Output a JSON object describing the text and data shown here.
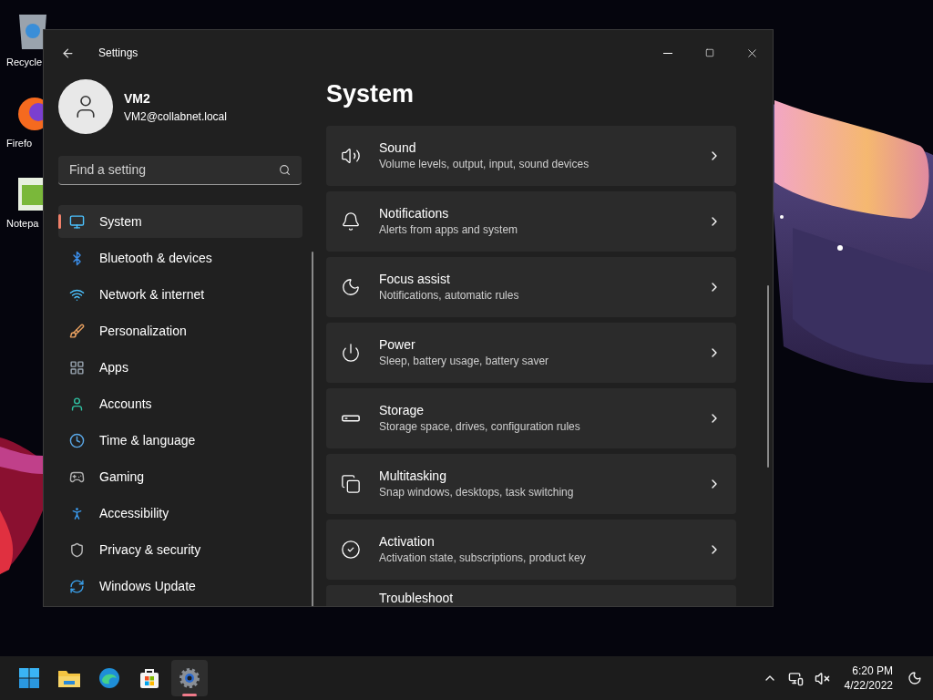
{
  "desktop": {
    "icons": [
      {
        "label": "Recycle"
      },
      {
        "label": "Firefo"
      },
      {
        "label": "Notepa"
      }
    ]
  },
  "window": {
    "title": "Settings",
    "account": {
      "name": "VM2",
      "email": "VM2@collabnet.local"
    },
    "search": {
      "placeholder": "Find a setting"
    },
    "nav": [
      {
        "label": "System",
        "selected": true
      },
      {
        "label": "Bluetooth & devices",
        "selected": false
      },
      {
        "label": "Network & internet",
        "selected": false
      },
      {
        "label": "Personalization",
        "selected": false
      },
      {
        "label": "Apps",
        "selected": false
      },
      {
        "label": "Accounts",
        "selected": false
      },
      {
        "label": "Time & language",
        "selected": false
      },
      {
        "label": "Gaming",
        "selected": false
      },
      {
        "label": "Accessibility",
        "selected": false
      },
      {
        "label": "Privacy & security",
        "selected": false
      },
      {
        "label": "Windows Update",
        "selected": false
      }
    ],
    "page_title": "System",
    "cards": [
      {
        "title": "Sound",
        "description": "Volume levels, output, input, sound devices"
      },
      {
        "title": "Notifications",
        "description": "Alerts from apps and system"
      },
      {
        "title": "Focus assist",
        "description": "Notifications, automatic rules"
      },
      {
        "title": "Power",
        "description": "Sleep, battery usage, battery saver"
      },
      {
        "title": "Storage",
        "description": "Storage space, drives, configuration rules"
      },
      {
        "title": "Multitasking",
        "description": "Snap windows, desktops, task switching"
      },
      {
        "title": "Activation",
        "description": "Activation state, subscriptions, product key"
      },
      {
        "title": "Troubleshoot"
      }
    ]
  },
  "taskbar": {
    "apps": [
      {
        "kind": "start",
        "selected": false
      },
      {
        "kind": "explorer",
        "selected": false
      },
      {
        "kind": "edge",
        "selected": false
      },
      {
        "kind": "store",
        "selected": false
      },
      {
        "kind": "settings",
        "selected": true
      }
    ],
    "clock": {
      "time": "6:20 PM",
      "date": "4/22/2022"
    }
  }
}
